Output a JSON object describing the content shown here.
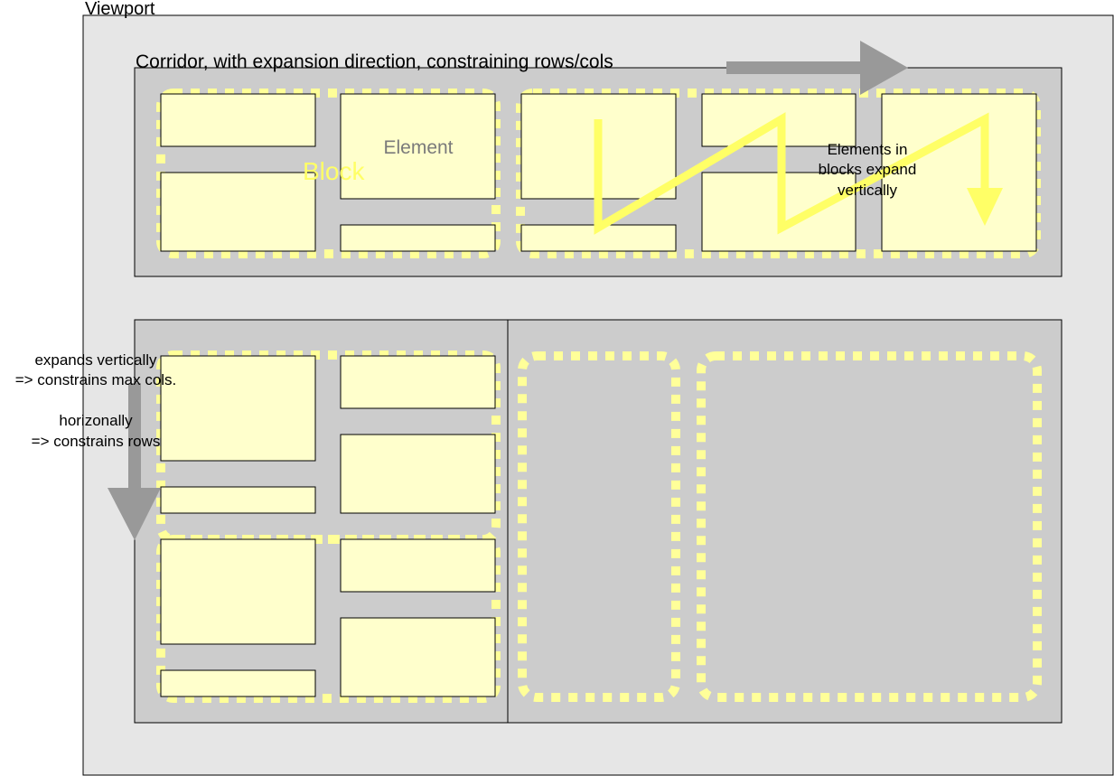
{
  "viewport": {
    "label": "Viewport"
  },
  "corridor_label": "Corridor, with expansion direction, constraining rows/cols",
  "element_label": "Element",
  "block_label": "Block",
  "notes": {
    "elements_expand": [
      "Elements in",
      "blocks expand",
      "vertically"
    ],
    "vertical": [
      "expands vertically",
      "=> constrains max cols."
    ],
    "horizontal": [
      "horizonally",
      "=> constrains rows"
    ]
  },
  "colors": {
    "page": "#ffffff",
    "viewport": "#e6e6e6",
    "corridor": "#cccccc",
    "element_fill": "#ffffcc",
    "block_dash": "#ffff99",
    "flow_line": "#ffff66",
    "arrow": "#999999",
    "stroke": "#000000"
  }
}
